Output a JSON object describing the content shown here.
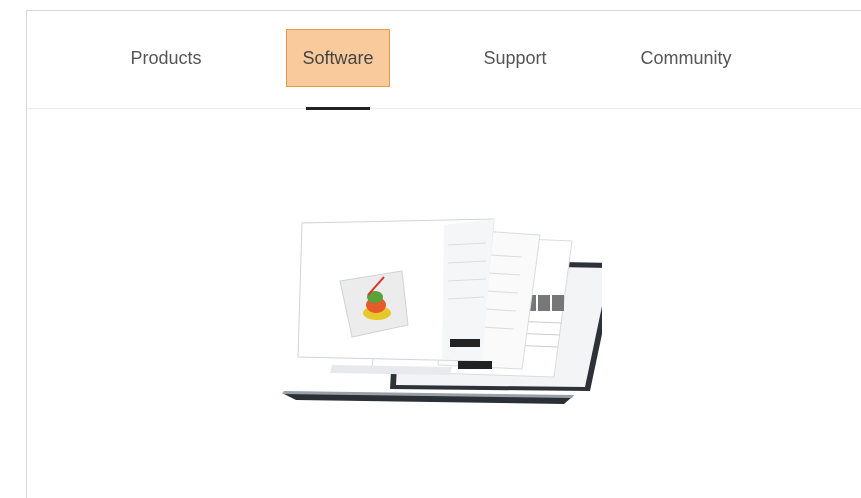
{
  "nav": {
    "items": [
      {
        "label": "Products"
      },
      {
        "label": "Software",
        "active": true
      },
      {
        "label": "Support"
      },
      {
        "label": "Community"
      }
    ]
  },
  "colors": {
    "active_bg": "#f9cb9c",
    "active_border": "#e69b4f",
    "underline": "#222222"
  },
  "hero": {
    "image": "software-screens-laptop-illustration"
  }
}
